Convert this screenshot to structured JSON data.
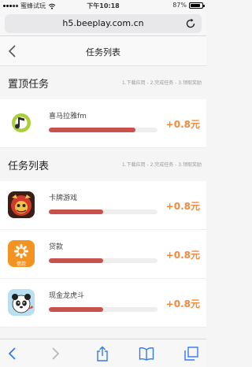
{
  "status_bar": {
    "carrier": "蜜蜂试玩",
    "time": "下午10:18",
    "battery": "87%",
    "battery_level": 0.87
  },
  "browser": {
    "url": "h5.beeplay.com.cn"
  },
  "nav": {
    "title": "任务列表"
  },
  "pinned_section": {
    "title": "置顶任务",
    "steps": "1.下载应用 - 2.完成任务 - 3.领取奖励"
  },
  "list_section": {
    "title": "任务列表",
    "steps": "1.下载应用 - 2.完成任务 - 3.领取奖励"
  },
  "pinned_tasks": [
    {
      "name": "喜马拉雅fm",
      "reward": "+0.8元",
      "progress": 0.8,
      "icon": "ximalaya-icon"
    }
  ],
  "tasks": [
    {
      "name": "卡牌游戏",
      "reward": "+0.8元",
      "progress": 0.5,
      "icon": "card-game-icon"
    },
    {
      "name": "贷款",
      "reward": "+0.8元",
      "progress": 0.5,
      "icon": "loan-icon",
      "icon_text": "借款"
    },
    {
      "name": "现金龙虎斗",
      "reward": "+0.8元",
      "progress": 0.5,
      "icon": "panda-game-icon"
    }
  ],
  "colors": {
    "progress": "#c9504d",
    "reward": "#f08a3e",
    "ios_blue": "#3478f6"
  }
}
